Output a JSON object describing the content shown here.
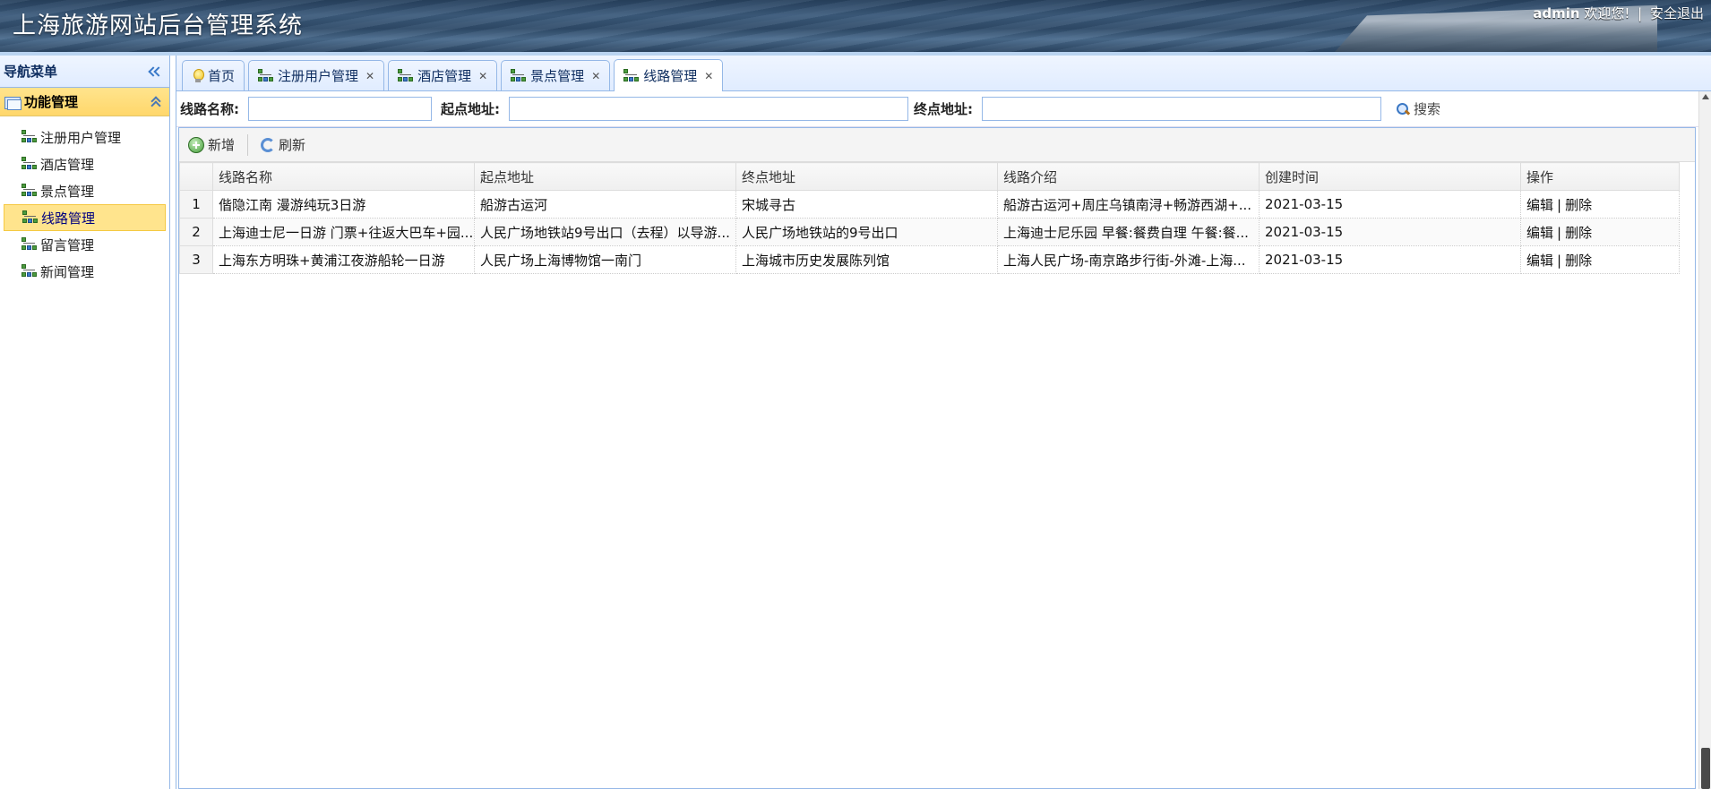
{
  "header": {
    "title": "上海旅游网站后台管理系统",
    "username": "admin",
    "welcome": "欢迎您!",
    "logout": "安全退出"
  },
  "sidebar": {
    "title": "导航菜单",
    "group": "功能管理",
    "items": [
      {
        "label": "注册用户管理",
        "active": false
      },
      {
        "label": "酒店管理",
        "active": false
      },
      {
        "label": "景点管理",
        "active": false
      },
      {
        "label": "线路管理",
        "active": true
      },
      {
        "label": "留言管理",
        "active": false
      },
      {
        "label": "新闻管理",
        "active": false
      }
    ]
  },
  "tabs": [
    {
      "label": "首页",
      "icon": "bulb-icon",
      "closable": false
    },
    {
      "label": "注册用户管理",
      "icon": "tree-icon",
      "closable": true
    },
    {
      "label": "酒店管理",
      "icon": "tree-icon",
      "closable": true
    },
    {
      "label": "景点管理",
      "icon": "tree-icon",
      "closable": true
    },
    {
      "label": "线路管理",
      "icon": "tree-icon",
      "closable": true,
      "active": true
    }
  ],
  "search": {
    "route_name_label": "线路名称:",
    "start_label": "起点地址:",
    "end_label": "终点地址:",
    "route_name_value": "",
    "start_value": "",
    "end_value": "",
    "button": "搜索"
  },
  "toolbar": {
    "add": "新增",
    "refresh": "刷新"
  },
  "grid": {
    "columns": [
      "线路名称",
      "起点地址",
      "终点地址",
      "线路介绍",
      "创建时间",
      "操作"
    ],
    "rows": [
      {
        "num": "1",
        "name": "偕隐江南 漫游纯玩3日游",
        "start": "船游古运河",
        "end": "宋城寻古",
        "intro": "船游古运河+周庄乌镇南浔+畅游西湖+...",
        "created": "2021-03-15"
      },
      {
        "num": "2",
        "name": "上海迪士尼一日游 门票+往返大巴车+园...",
        "start": "人民广场地铁站9号出口（去程）以导游...",
        "end": "人民广场地铁站的9号出口",
        "intro": "上海迪士尼乐园 早餐:餐费自理 午餐:餐...",
        "created": "2021-03-15"
      },
      {
        "num": "3",
        "name": "上海东方明珠+黄浦江夜游船轮一日游",
        "start": "人民广场上海博物馆一南门",
        "end": "上海城市历史发展陈列馆",
        "intro": "上海人民广场-南京路步行街-外滩-上海...",
        "created": "2021-03-15"
      }
    ],
    "edit": "编辑",
    "separator": "|",
    "delete": "删除"
  }
}
